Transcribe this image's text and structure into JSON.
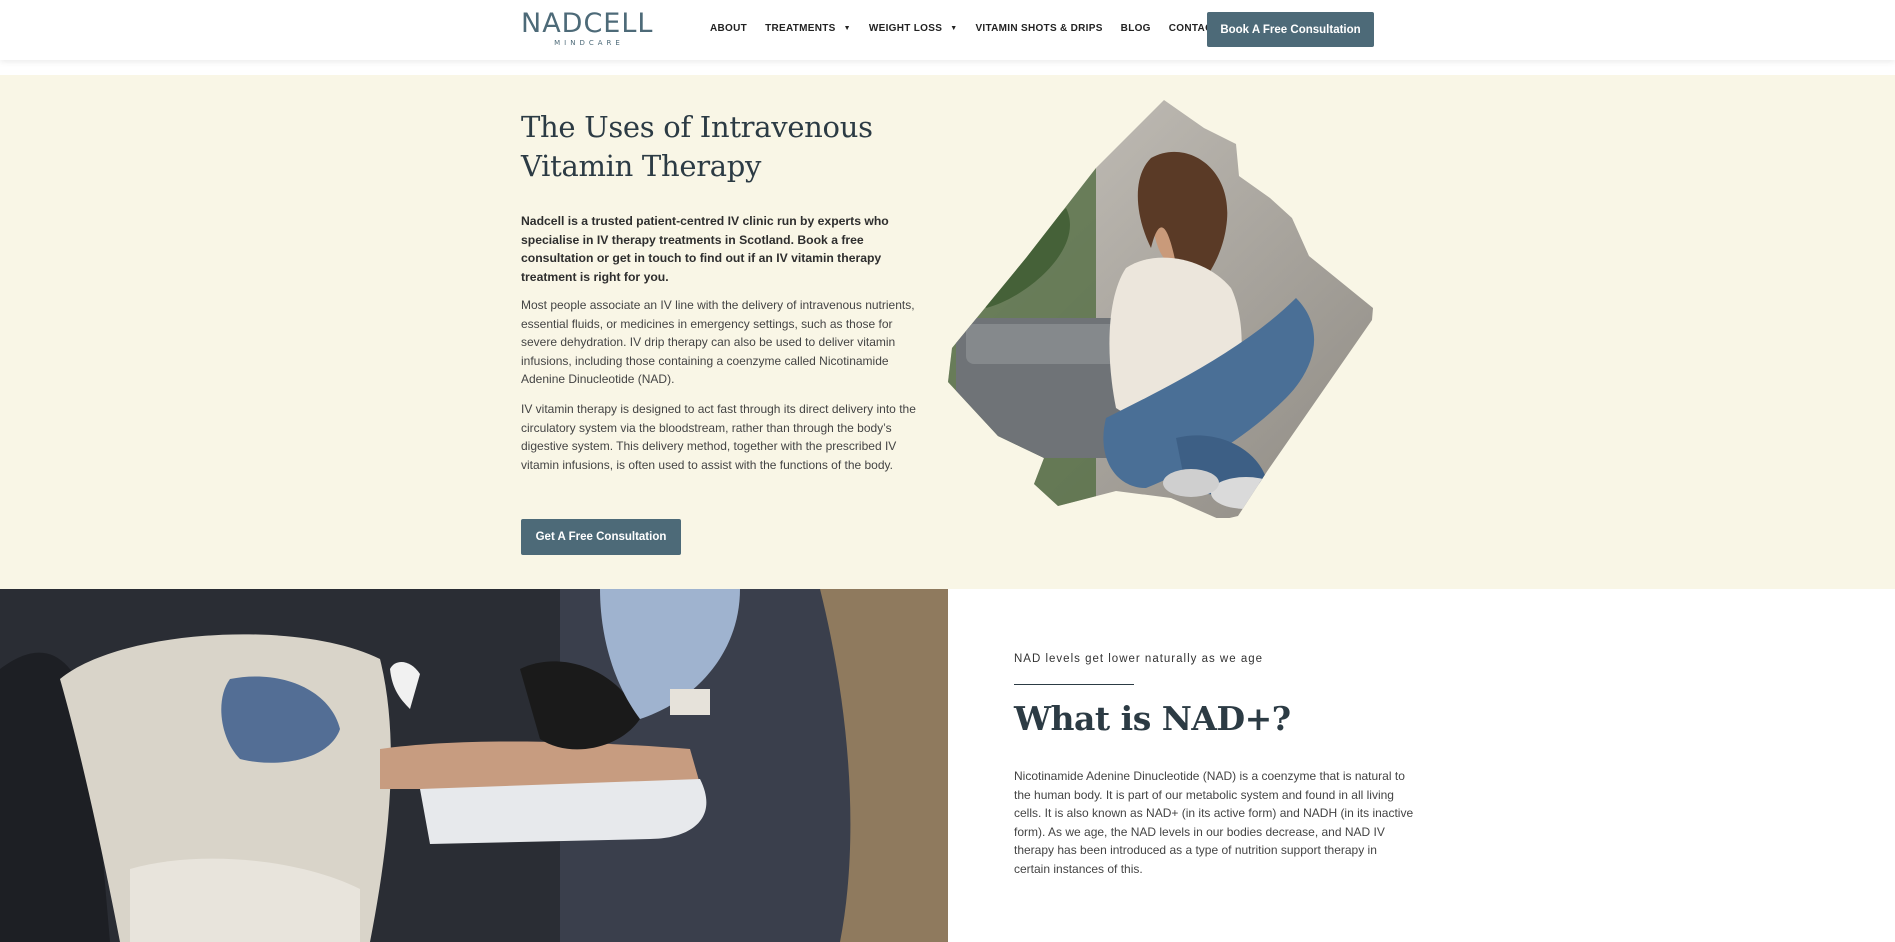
{
  "header": {
    "logo": {
      "main": "NADCELL",
      "sub": "MINDCARE"
    },
    "nav": [
      {
        "label": "ABOUT",
        "has_dropdown": false
      },
      {
        "label": "TREATMENTS",
        "has_dropdown": true
      },
      {
        "label": "WEIGHT LOSS",
        "has_dropdown": true
      },
      {
        "label": "VITAMIN SHOTS & DRIPS",
        "has_dropdown": false
      },
      {
        "label": "BLOG",
        "has_dropdown": false
      },
      {
        "label": "CONTACT US",
        "has_dropdown": false
      }
    ],
    "cta_label": "Book A Free Consultation"
  },
  "intro": {
    "title": "The Uses of Intravenous Vitamin Therapy",
    "lead": "Nadcell is a trusted patient-centred IV clinic run by experts who specialise in IV therapy treatments in Scotland. Book a free consultation or get in touch to find out if an IV vitamin therapy treatment is right for you.",
    "paragraph1": "Most people associate an IV line with the delivery of intravenous nutrients, essential fluids, or medicines in emergency settings, such as those for severe dehydration. IV drip therapy can also be used to deliver vitamin infusions, including those containing a coenzyme called Nicotinamide Adenine Dinucleotide (NAD).",
    "paragraph2": "IV vitamin therapy is designed to act fast through its direct delivery into the circulatory system via the bloodstream, rather than through the body’s digestive system. This delivery method, together with the prescribed IV vitamin infusions, is often used to assist with the functions of the body.",
    "cta_label": "Get A Free Consultation"
  },
  "nad": {
    "eyebrow": "NAD levels get lower naturally as we age",
    "title": "What is NAD+?",
    "paragraph": "Nicotinamide Adenine Dinucleotide (NAD) is a coenzyme that is natural to the human body. It is part of our metabolic system and found in all living cells. It is also known as NAD+ (in its active form) and NADH (in its inactive form). As we age, the NAD levels in our bodies decrease, and NAD IV therapy has been introduced as a type of nutrition support therapy in certain instances of this."
  },
  "colors": {
    "brand": "#4d6a78",
    "cream": "#f9f6e6",
    "heading": "#2c3b44"
  }
}
